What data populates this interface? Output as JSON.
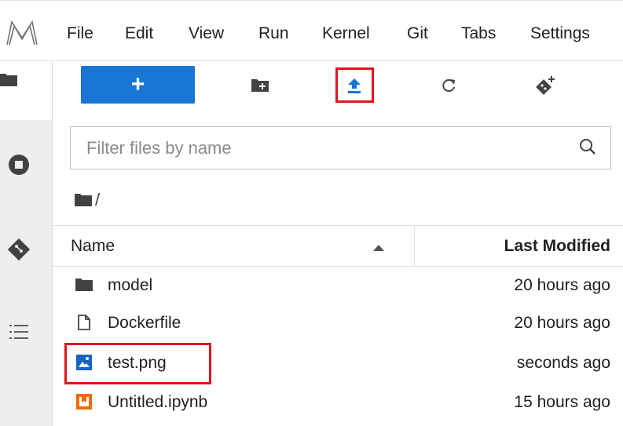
{
  "menu": {
    "items": [
      "File",
      "Edit",
      "View",
      "Run",
      "Kernel",
      "Git",
      "Tabs",
      "Settings"
    ]
  },
  "toolbar": {
    "new_label": "+",
    "icons": [
      "new-folder-icon",
      "upload-icon",
      "refresh-icon",
      "git-clone-icon"
    ]
  },
  "sidebar": {
    "icons": [
      "folder-icon",
      "running-sessions-icon",
      "git-icon",
      "table-of-contents-icon"
    ]
  },
  "filter": {
    "placeholder": "Filter files by name"
  },
  "breadcrumb": {
    "path": "/"
  },
  "listing": {
    "columns": {
      "name": "Name",
      "last_modified": "Last Modified"
    },
    "rows": [
      {
        "name": "model",
        "modified": "20 hours ago",
        "icon": "folder-icon"
      },
      {
        "name": "Dockerfile",
        "modified": "20 hours ago",
        "icon": "file-icon"
      },
      {
        "name": "test.png",
        "modified": "seconds ago",
        "icon": "image-icon"
      },
      {
        "name": "Untitled.ipynb",
        "modified": "15 hours ago",
        "icon": "notebook-icon"
      }
    ]
  },
  "colors": {
    "accent": "#1976d2",
    "highlight": "#e2131f",
    "notebook": "#ef6c00"
  }
}
